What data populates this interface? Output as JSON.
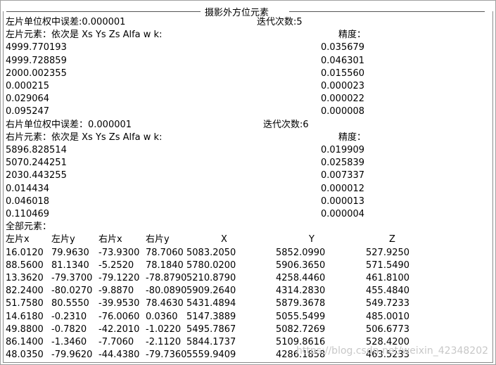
{
  "group_title": "摄影外方位元素",
  "left": {
    "rms_label": "左片单位权中误差:0.000001",
    "iter_label": "迭代次数:5",
    "elements_header": "左片元素：依次是 Xs  Ys  Zs   Alfa   w   k:",
    "precision_header": "精度：",
    "values": [
      "4999.770193",
      "4999.728859",
      "2000.002355",
      "0.000215",
      "0.029064",
      "0.095247"
    ],
    "precisions": [
      "0.035679",
      "0.046301",
      "0.015560",
      "0.000023",
      "0.000022",
      "0.000008"
    ]
  },
  "right": {
    "rms_label": "右片单位权中误差：0.000001",
    "iter_label": "迭代次数:6",
    "elements_header": "右片元素：依次是 Xs  Ys  Zs   Alfa   w   k:",
    "precision_header": "精度：",
    "values": [
      "5896.828514",
      "5070.244251",
      "2030.443255",
      "0.014434",
      "0.046018",
      "0.110469"
    ],
    "precisions": [
      "0.019909",
      "0.025839",
      "0.007337",
      "0.000012",
      "0.000013",
      "0.000004"
    ]
  },
  "all": {
    "label": "全部元素：",
    "headers": [
      "左片x",
      "左片y",
      "右片x",
      "右片y",
      "X",
      "Y",
      "Z"
    ],
    "rows": [
      [
        "16.0120",
        "79.9630",
        "-73.9300",
        "78.7060",
        "5083.2050",
        "5852.0990",
        "527.9250"
      ],
      [
        "88.5600",
        "81.1340",
        "-5.2520",
        "78.1840",
        "5780.0200",
        "5906.3650",
        "571.5490"
      ],
      [
        "13.3620",
        "-79.3700",
        "-79.1220",
        "-78.8790",
        "5210.8790",
        "4258.4460",
        "461.8100"
      ],
      [
        "82.2400",
        "-80.0270",
        "-9.8870",
        "-80.0890",
        "5909.2640",
        "4314.2830",
        "455.4840"
      ],
      [
        "51.7580",
        "80.5550",
        "-39.9530",
        "78.4630",
        "5431.4894",
        "5879.3678",
        "549.7233"
      ],
      [
        "14.6180",
        "-0.2310",
        "-76.0060",
        "0.0360",
        "5147.3889",
        "5055.5499",
        "485.0010"
      ],
      [
        "49.8800",
        "-0.7820",
        "-42.2010",
        "-1.0220",
        "5495.7867",
        "5082.7269",
        "506.6773"
      ],
      [
        "86.1400",
        "-1.3460",
        "-7.7060",
        "-2.1120",
        "5844.1737",
        "5109.8616",
        "528.4200"
      ],
      [
        "48.0350",
        "-79.9620",
        "-44.4380",
        "-79.7360",
        "5559.9409",
        "4286.1858",
        "463.5233"
      ]
    ]
  },
  "watermark": "https://blog.csdn.net/weixin_42348202"
}
